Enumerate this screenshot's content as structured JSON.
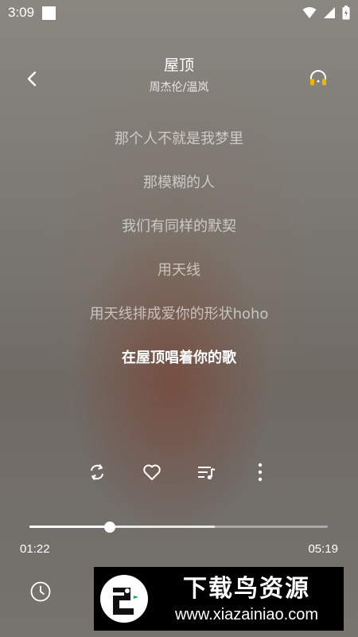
{
  "status_bar": {
    "time": "3:09"
  },
  "header": {
    "title": "屋顶",
    "artist": "周杰伦/温岚"
  },
  "lyrics": {
    "lines": [
      "那个人不就是我梦里",
      "那模糊的人",
      "我们有同样的默契",
      "用天线",
      "用天线排成爱你的形状hoho",
      "在屋顶唱着你的歌"
    ],
    "current_index": 5
  },
  "controls": {
    "icons": [
      "repeat-icon",
      "heart-icon",
      "playlist-icon",
      "more-vert-icon"
    ]
  },
  "progress": {
    "current_time": "01:22",
    "total_time": "05:19",
    "played_fraction": 0.27,
    "buffered_fraction": 0.62
  },
  "watermark": {
    "title": "下载鸟资源",
    "url": "www.xiazainiao.com"
  },
  "colors": {
    "accent_headphone": "#f0b400",
    "text": "#ffffff"
  }
}
